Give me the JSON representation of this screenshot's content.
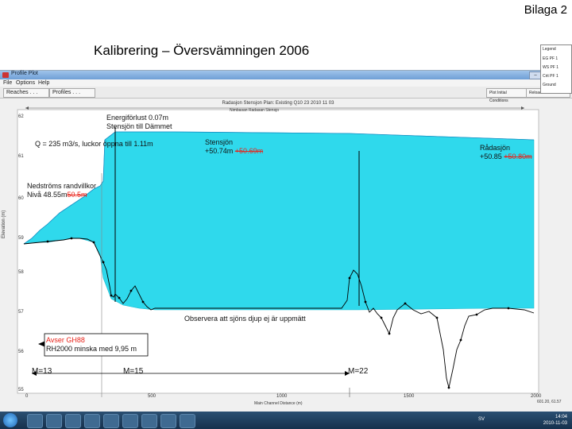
{
  "slide": {
    "page_label": "Bilaga 2",
    "title": "Kalibrering – Översvämningen 2006"
  },
  "window": {
    "app_title": "Profile Plot",
    "menu": [
      "File",
      "Options",
      "Help"
    ],
    "toolbar": {
      "reaches_label": "Reaches . . .",
      "profiles_label": "Profiles . . .",
      "plot_label": "Plot Initial Conditions",
      "reload_label": "Reload Data"
    },
    "plot_title": "Radasjon Stensjon      Plan: Existing Q10 23      2010 11 03",
    "plot_subtitle": "Nimbasan Radasan Stensjo",
    "legend": [
      "Legend",
      "EG PF 1",
      "WS PF 1",
      "Crit PF 1",
      "Ground"
    ],
    "x_axis_label": "Main Channel Distance (m)",
    "y_axis_label": "Elevation (m)",
    "y_ticks": [
      "62",
      "61",
      "60",
      "59",
      "58",
      "57",
      "56",
      "55"
    ],
    "x_ticks": [
      "0",
      "500",
      "1000",
      "1500",
      "2000"
    ],
    "corner_readout": "601.20, 61.57"
  },
  "annotations": {
    "energy_loss": "Energiförlust 0.07m",
    "energy_loss_sub": "Stensjön till Dämmet",
    "flow": "Q = 235 m3/s, luckor öppna till 1.11m",
    "stensjon_name": "Stensjön",
    "stensjon_level": "+50.74m",
    "stensjon_old": "+50.69m",
    "radasjon_name": "Rådasjön",
    "radasjon_level": "+50.85",
    "radasjon_old": "+50.80m",
    "downstream_1": "Nedströms randvillkor",
    "downstream_2_a": "Nivå 48.55m",
    "downstream_2_old": "50.5m",
    "observe": "Observera att sjöns djup ej är uppmätt",
    "datum_1": "Avser GH88",
    "datum_2": "RH2000 minska med 9,95 m",
    "m13": "M=13",
    "m15": "M=15",
    "m22": "M=22"
  },
  "taskbar": {
    "lang": "SV",
    "time": "14:04",
    "date": "2010-11-03"
  },
  "colors": {
    "water": "#2fd9ec",
    "ground": "#000000",
    "annotation_red": "#e8231a",
    "axis_line": "#000000"
  }
}
